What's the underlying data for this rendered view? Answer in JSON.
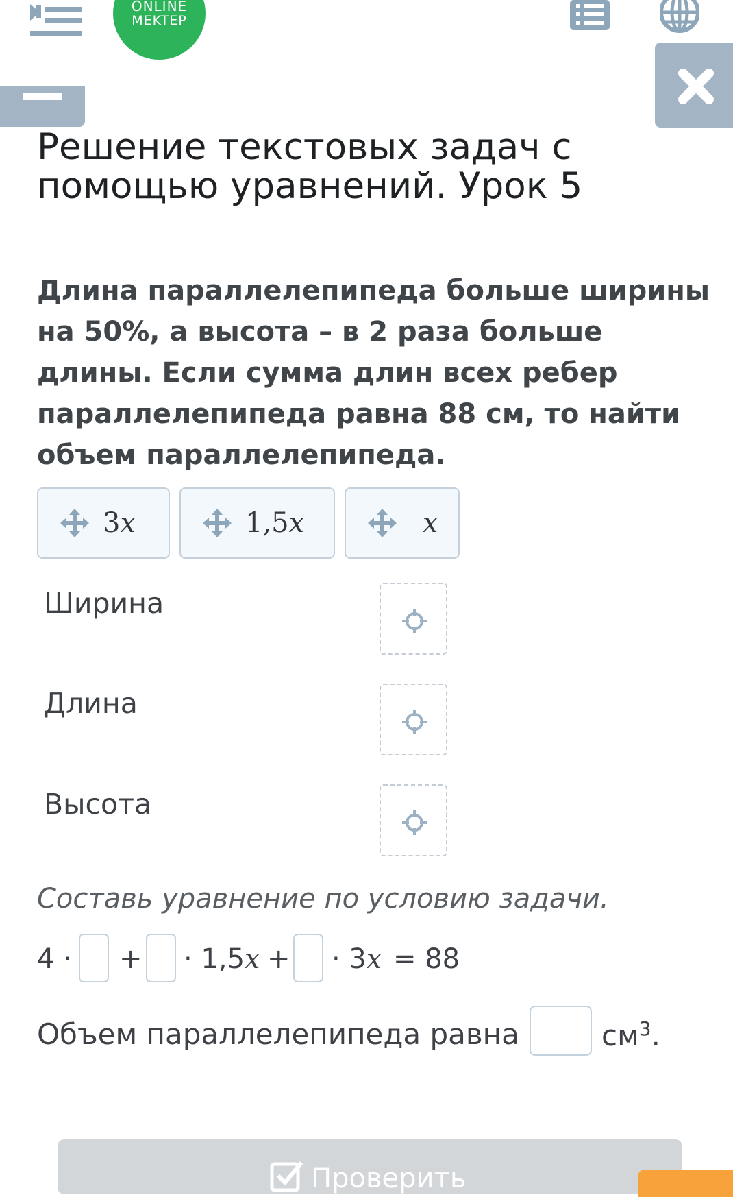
{
  "header": {
    "logo_line1": "ONLINE",
    "logo_line2": "MEKTEP"
  },
  "page_title": "Решение текстовых задач с помощью уравнений. Урок 5",
  "question": "Длина параллелепипеда больше ширины на 50%, а высота – в 2 раза больше длины. Если сумма длин всех ребер параллелепипеда равна 88 см, то найти объем параллелепипеда.",
  "chips": [
    {
      "coef": "3",
      "var": "x"
    },
    {
      "coef": "1,5",
      "var": "x"
    },
    {
      "coef": "",
      "var": "x"
    }
  ],
  "rows": [
    {
      "label": "Ширина"
    },
    {
      "label": "Длина"
    },
    {
      "label": "Высота"
    }
  ],
  "instruction": "Составь уравнение по условию задачи.",
  "equation": {
    "start": "4 ·",
    "plus1": "+",
    "term2": "· 1,5",
    "var": "x",
    "plus2": "+",
    "term3": "· 3",
    "end": "= 88"
  },
  "volume": {
    "text": "Объем параллелепипеда равна –",
    "unit": "см",
    "unit_exp": "3",
    "end": "."
  },
  "check_button": "Проверить",
  "colors": {
    "logo_green": "#2db45a",
    "tab_grey": "#a3b5c4",
    "chip_border": "#c4d1dc",
    "orange": "#f7a23b"
  }
}
